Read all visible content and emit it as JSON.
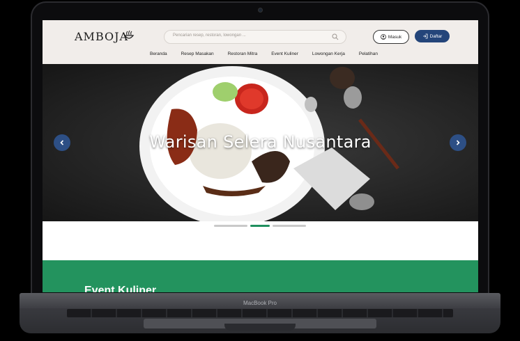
{
  "device": {
    "model_label": "MacBook Pro"
  },
  "brand": {
    "name": "AMBOJA"
  },
  "search": {
    "placeholder": "Pencarian resep, restoran, lowongan ..."
  },
  "auth": {
    "login_label": "Masuk",
    "register_label": "Daftar"
  },
  "nav": {
    "items": [
      {
        "label": "Beranda"
      },
      {
        "label": "Resep Masakan"
      },
      {
        "label": "Restoran Mitra"
      },
      {
        "label": "Event Kuliner"
      },
      {
        "label": "Lowongan Kerja"
      },
      {
        "label": "Pelatihan"
      }
    ]
  },
  "hero": {
    "title": "Warisan Selera Nusantara",
    "slide_count": 3,
    "active_slide": 2
  },
  "section": {
    "title": "Event Kuliner"
  },
  "colors": {
    "primary_blue": "#24457a",
    "accent_green": "#23935e",
    "header_bg": "#f1edea"
  }
}
